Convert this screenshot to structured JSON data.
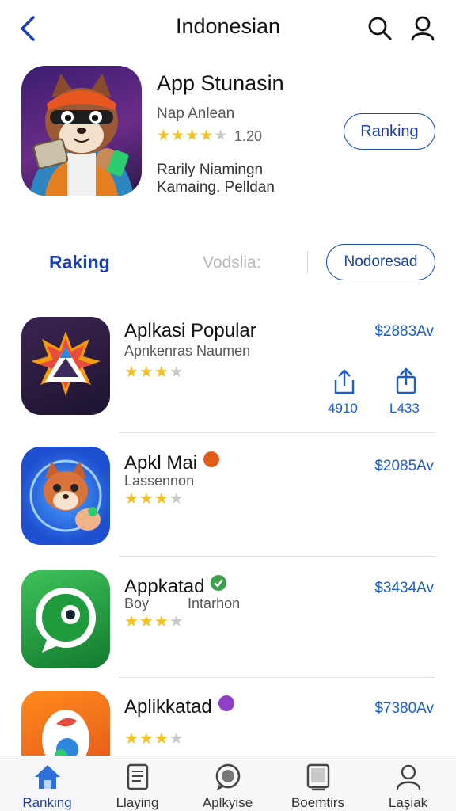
{
  "header": {
    "title": "Indonesian",
    "back_icon": "chevron-left-icon",
    "search_icon": "search-icon",
    "profile_icon": "user-icon"
  },
  "featured": {
    "name": "App Stunasin",
    "developer": "Nap Anlean",
    "stars": 4,
    "rating": "1.20",
    "desc_line1": "Rarily Niamingn",
    "desc_line2": "Kamaing. Pelldan",
    "button": "Ranking"
  },
  "tabs": {
    "active": "Raking",
    "inactive": "Vodslia:",
    "button": "Nodoresad"
  },
  "apps": [
    {
      "name": "Aplkasi Popular",
      "subtitle": "Apnkenras Naumen",
      "stars": 3,
      "price": "$2883Av",
      "actions": [
        {
          "icon": "share-icon",
          "label": "4910"
        },
        {
          "icon": "upload-icon",
          "label": "L433"
        }
      ]
    },
    {
      "name": "Apkl Mai",
      "subtitle": "Lassennon",
      "badge_color": "#e05a1a",
      "stars": 3,
      "price": "$2085Av"
    },
    {
      "name": "Appkatad",
      "subtitle": "Boy",
      "subtitle2": "Intarhon",
      "badge_color": "#3aa34a",
      "stars": 3,
      "price": "$3434Av"
    },
    {
      "name": "Aplikkatad",
      "badge_color": "#8e3fc7",
      "stars": 3,
      "price": "$7380Av"
    }
  ],
  "bottom_nav": [
    {
      "label": "Ranking",
      "icon": "home-icon",
      "active": true
    },
    {
      "label": "Llaying",
      "icon": "document-icon",
      "active": false
    },
    {
      "label": "Aplkyise",
      "icon": "chat-icon",
      "active": false
    },
    {
      "label": "Boemtirs",
      "icon": "tablet-icon",
      "active": false
    },
    {
      "label": "Laşiak",
      "icon": "user-icon",
      "active": false
    }
  ],
  "colors": {
    "accent": "#1a3fa0",
    "price": "#1a5ed0",
    "star": "#f3c121",
    "star_empty": "#c9c9c9"
  }
}
